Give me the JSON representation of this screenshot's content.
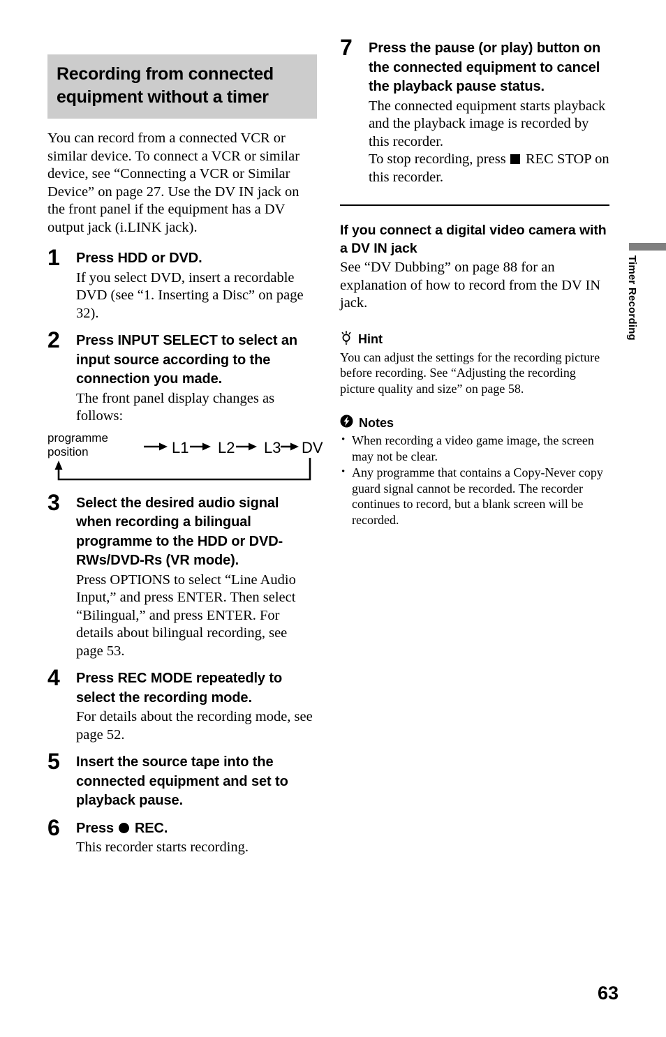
{
  "document": {
    "page_number": "63",
    "side_tab_label": "Timer Recording"
  },
  "left_column": {
    "section_heading": "Recording from connected equipment without a timer",
    "intro_paragraph": "You can record from a connected VCR or similar device. To connect a VCR or similar device, see “Connecting a VCR or Similar Device” on page 27. Use the DV IN jack on the front panel if the equipment has a DV output jack (i.LINK jack).",
    "steps": [
      {
        "number": "1",
        "title": "Press HDD or DVD.",
        "body": "If you select DVD, insert a recordable DVD (see “1. Inserting a Disc” on page 32)."
      },
      {
        "number": "2",
        "title": "Press INPUT SELECT to select an input source according to the connection you made.",
        "body": "The front panel display changes as follows:"
      },
      {
        "number": "3",
        "title": "Select the desired audio signal when recording a bilingual programme to the HDD or DVD-RWs/DVD-Rs (VR mode).",
        "body": "Press OPTIONS to select “Line Audio Input,” and press ENTER. Then select “Bilingual,” and press ENTER. For details about bilingual recording, see page 53."
      },
      {
        "number": "4",
        "title": "Press REC MODE repeatedly to select the recording mode.",
        "body": "For details about the recording mode, see page 52."
      },
      {
        "number": "5",
        "title": "Insert the source tape into the connected equipment and set to playback pause.",
        "body": ""
      },
      {
        "number": "6",
        "title_prefix": "Press",
        "title_suffix": "REC.",
        "body": "This recorder starts recording."
      }
    ],
    "flow_diagram": {
      "label_line1": "programme",
      "label_line2": "position",
      "nodes": [
        "L1",
        "L2",
        "L3",
        "DV"
      ],
      "loops_back": true
    }
  },
  "right_column": {
    "step7": {
      "number": "7",
      "title": "Press the pause (or play) button on the connected equipment to cancel the playback pause status.",
      "body_1": "The connected equipment starts playback and the playback image is recorded by this recorder.",
      "body_2_prefix": "To stop recording, press",
      "body_2_suffix": "REC STOP on this recorder."
    },
    "subsection": {
      "heading": "If you connect a digital video camera with a DV IN jack",
      "body": "See “DV Dubbing” on page 88 for an explanation of how to record from the DV IN jack."
    },
    "hint": {
      "icon": "lightbulb-icon",
      "heading": "Hint",
      "body": "You can adjust the settings for the recording picture before recording. See “Adjusting the recording picture quality and size” on page 58."
    },
    "notes": {
      "icon": "lightning-circle-icon",
      "heading": "Notes",
      "items": [
        "When recording a video game image, the screen may not be clear.",
        "Any programme that contains a Copy-Never copy guard signal cannot be recorded. The recorder continues to record, but a blank screen will be recorded."
      ]
    }
  },
  "colors": {
    "heading_band": "#cccccc",
    "tab_bar": "#808080",
    "text": "#000000"
  }
}
